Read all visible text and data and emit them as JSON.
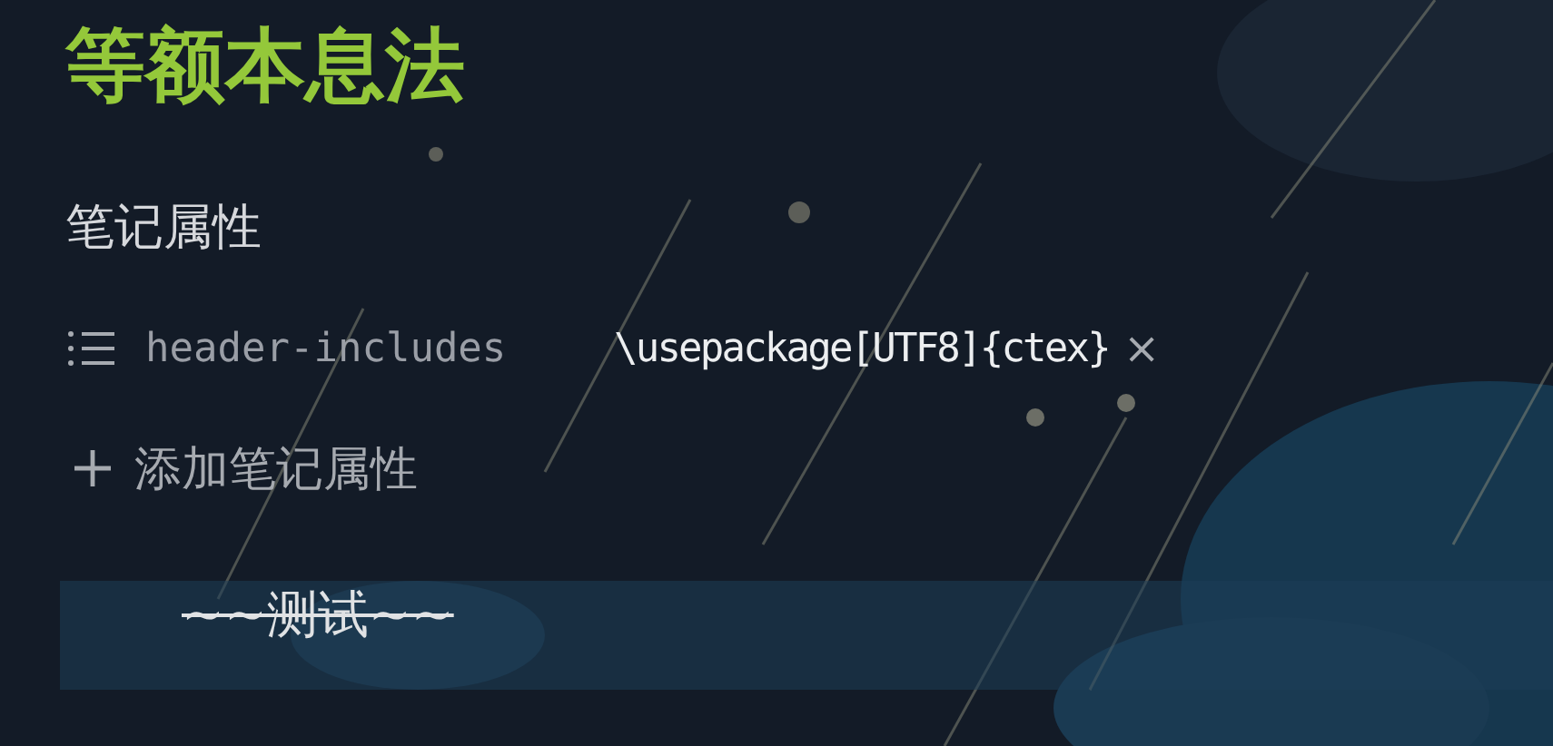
{
  "title": "等额本息法",
  "properties": {
    "heading": "笔记属性",
    "items": [
      {
        "key": "header-includes",
        "value": "\\usepackage[UTF8]{ctex}",
        "remove": "×"
      }
    ],
    "add_label": "添加笔记属性"
  },
  "editor_line": {
    "text": "~~测试~~",
    "strikethrough": true,
    "active": true
  }
}
